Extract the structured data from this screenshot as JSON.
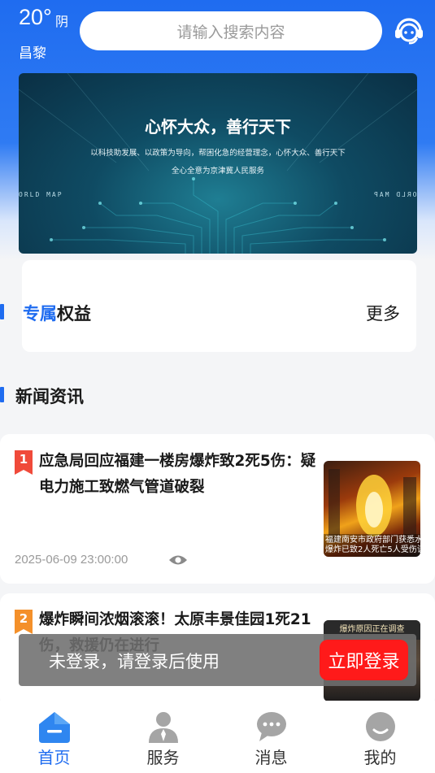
{
  "header": {
    "temperature": "20°",
    "condition": "阴",
    "city": "昌黎",
    "search_placeholder": "请输入搜索内容",
    "service_icon": "customer-service-icon"
  },
  "banner": {
    "title": "心怀大众，善行天下",
    "subtitle_line1": "以科技助发展、以政策为导向，帮困化急的经营理念，心怀大众、善行天下",
    "subtitle_line2": "全心全意为京津冀人民服务",
    "map_text": "ORLD MAP"
  },
  "rights": {
    "title_highlight": "专属",
    "title_rest": "权益",
    "more_label": "更多"
  },
  "news_section": {
    "title": "新闻资讯",
    "items": [
      {
        "rank": "1",
        "rank_color": "#f04a3a",
        "headline": "应急局回应福建一楼房爆炸致2死5伤：疑电力施工致燃气管道破裂",
        "date": "2025-06-09 23:00:00",
        "thumb_caption_1": "福建南安市政府部门获悉水",
        "thumb_caption_2": "爆炸已致2人死亡5人受伤该"
      },
      {
        "rank": "2",
        "rank_color": "#f4902a",
        "headline": "爆炸瞬间浓烟滚滚！太原丰景佳园1死21伤，救援仍在进行",
        "thumb_top_text": "爆炸原因正在调查"
      }
    ]
  },
  "toast": {
    "message": "未登录，请登录后使用",
    "login_label": "立即登录"
  },
  "tabbar": {
    "tabs": [
      {
        "label": "首页",
        "icon": "home-icon",
        "active": true
      },
      {
        "label": "服务",
        "icon": "user-service-icon",
        "active": false
      },
      {
        "label": "消息",
        "icon": "message-icon",
        "active": false
      },
      {
        "label": "我的",
        "icon": "profile-icon",
        "active": false
      }
    ]
  },
  "colors": {
    "primary": "#1f6cf0",
    "login_button": "#ff1a1a",
    "rank1": "#f04a3a",
    "rank2": "#f4902a"
  }
}
